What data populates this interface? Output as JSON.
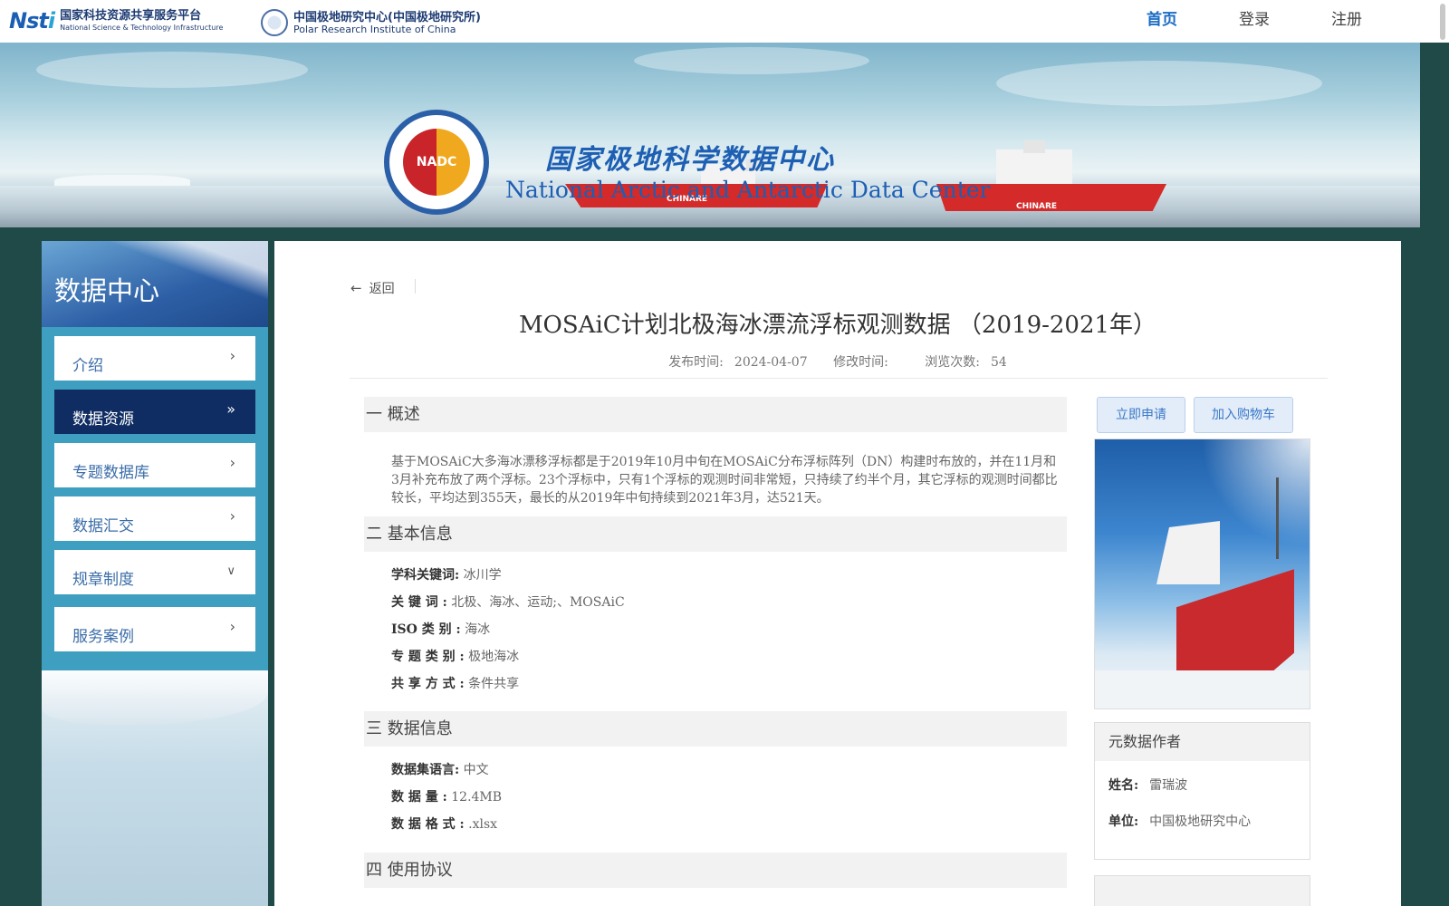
{
  "header": {
    "nsti_logo": {
      "mark": "Nsti",
      "cn": "国家科技资源共享服务平台",
      "en": "National Science & Technology Infrastructure"
    },
    "pric_logo": {
      "cn": "中国极地研究中心(中国极地研究所)",
      "en": "Polar Research Institute of China"
    },
    "nav": [
      {
        "label": "首页",
        "active": true
      },
      {
        "label": "登录",
        "active": false
      },
      {
        "label": "注册",
        "active": false
      }
    ]
  },
  "banner": {
    "seal_text": "NADC",
    "title_cn": "国家极地科学数据中心",
    "title_en": "National Arctic and Antarctic Data Center",
    "ship_label": "CHINARE"
  },
  "sidebar": {
    "title": "数据中心",
    "items": [
      {
        "label": "介绍",
        "icon": "chevron-right-icon",
        "active": false
      },
      {
        "label": "数据资源",
        "icon": "double-chevron-right-icon",
        "active": true
      },
      {
        "label": "专题数据库",
        "icon": "chevron-right-icon",
        "active": false
      },
      {
        "label": "数据汇交",
        "icon": "chevron-right-icon",
        "active": false
      },
      {
        "label": "规章制度",
        "icon": "chevron-down-icon",
        "active": false
      },
      {
        "label": "服务案例",
        "icon": "chevron-right-icon",
        "active": false
      }
    ]
  },
  "detail": {
    "back_label": "返回",
    "title": "MOSAiC计划北极海冰漂流浮标观测数据 （2019-2021年）",
    "meta": {
      "publish_label": "发布时间:",
      "publish_date": "2024-04-07",
      "modify_label": "修改时间:",
      "modify_date": "",
      "views_label": "浏览次数:",
      "views": "54"
    },
    "sections": {
      "overview": "一 概述",
      "basic": "二 基本信息",
      "data": "三  数据信息",
      "license": "四  使用协议"
    },
    "abstract": "基于MOSAiC大多海冰漂移浮标都是于2019年10月中旬在MOSAiC分布浮标阵列（DN）构建时布放的，并在11月和3月补充布放了两个浮标。23个浮标中，只有1个浮标的观测时间非常短，只持续了约半个月，其它浮标的观测时间都比较长，平均达到355天，最长的从2019年中旬持续到2021年3月，达521天。",
    "basic_info": [
      {
        "key": "学科关键词:",
        "value": "冰川学"
      },
      {
        "key": "关  键  词 :",
        "value": "北极、海冰、运动;、MOSAiC"
      },
      {
        "key": "ISO 类 别 :",
        "value": "海冰"
      },
      {
        "key": "专 题 类 别 :",
        "value": "极地海冰"
      },
      {
        "key": "共 享 方 式 :",
        "value": "条件共享"
      }
    ],
    "data_info": [
      {
        "key": "数据集语言:",
        "value": "中文"
      },
      {
        "key": "数  据  量  :",
        "value": "12.4MB"
      },
      {
        "key": "数 据 格 式 :",
        "value": ".xlsx"
      }
    ]
  },
  "right": {
    "apply_button": "立即申请",
    "cart_button": "加入购物车",
    "author": {
      "heading": "元数据作者",
      "name_label": "姓名:",
      "name": "雷瑞波",
      "unit_label": "单位:",
      "unit": "中国极地研究中心"
    }
  },
  "colors": {
    "accent": "#1a6cc4",
    "sidebar_bg": "#3e9fc1",
    "sidebar_active": "#0f2d63",
    "page_bg": "#1f4a48"
  }
}
